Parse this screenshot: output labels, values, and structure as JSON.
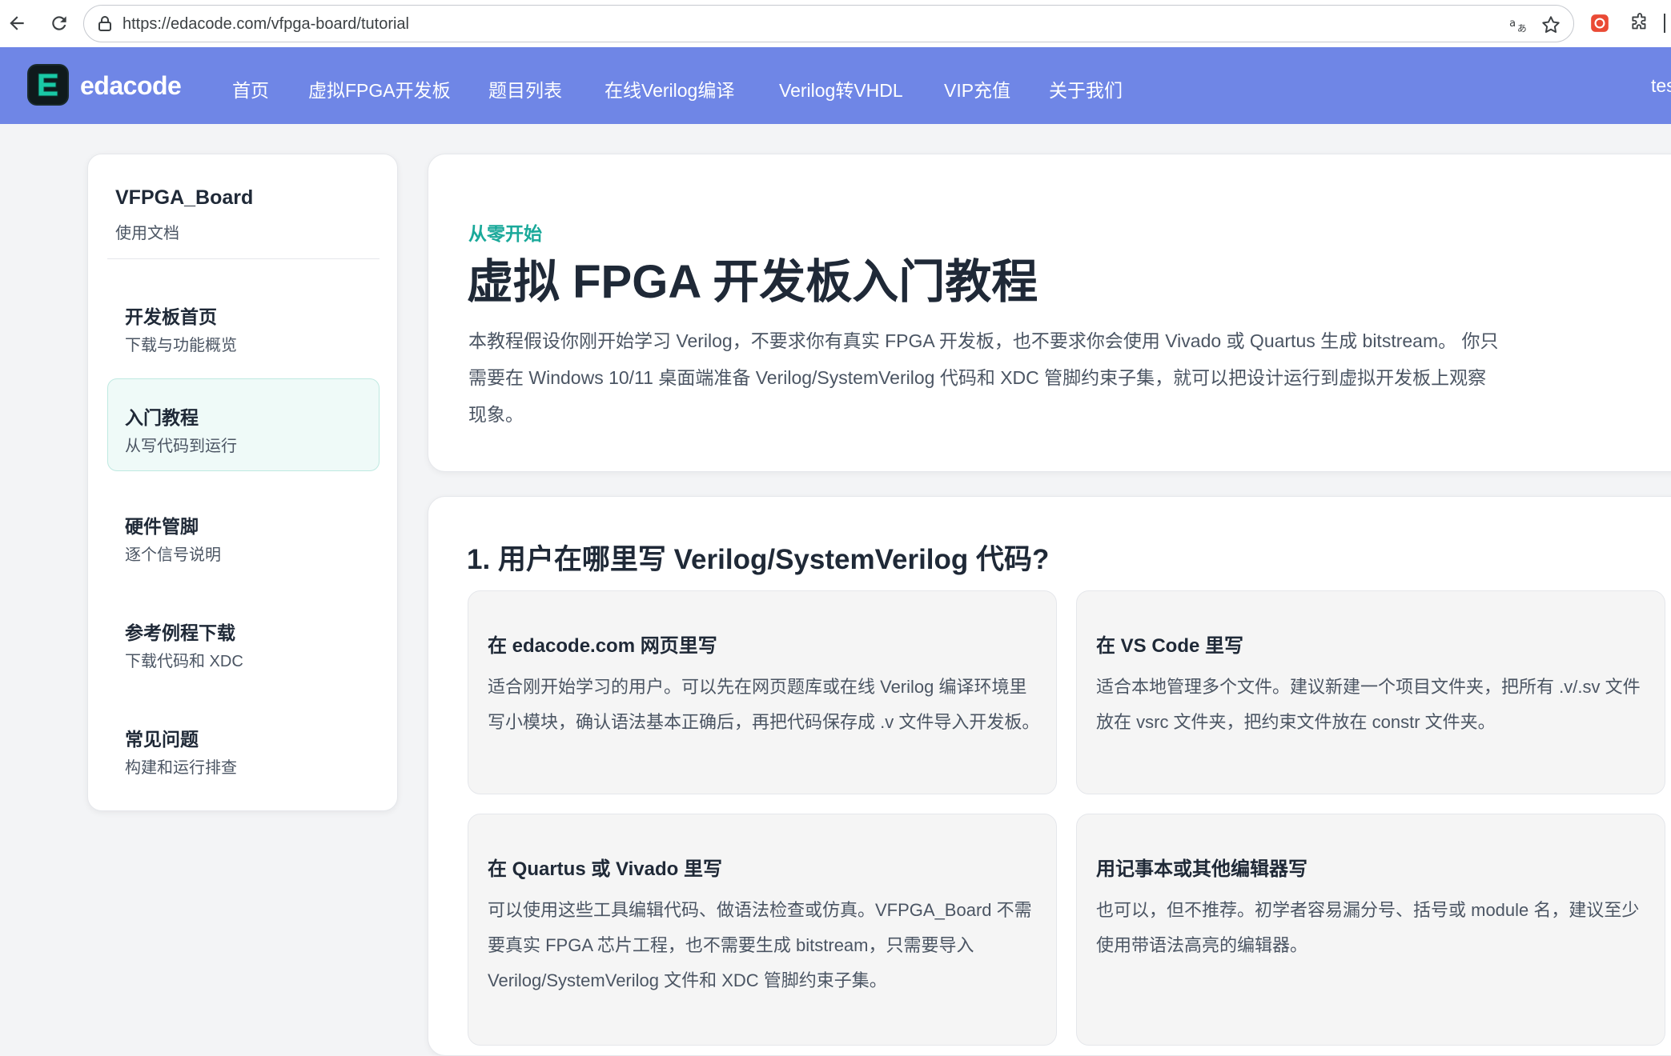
{
  "browser": {
    "url": "https://edacode.com/vfpga-board/tutorial"
  },
  "header": {
    "logo_text": "edacode",
    "nav": [
      {
        "label": "首页"
      },
      {
        "label": "虚拟FPGA开发板"
      },
      {
        "label": "题目列表"
      },
      {
        "label": "在线Verilog编译"
      },
      {
        "label": "Verilog转VHDL"
      },
      {
        "label": "VIP充值"
      },
      {
        "label": "关于我们"
      }
    ],
    "user_partial": "tes"
  },
  "sidebar": {
    "title": "VFPGA_Board",
    "subtitle": "使用文档",
    "items": [
      {
        "title": "开发板首页",
        "desc": "下载与功能概览"
      },
      {
        "title": "入门教程",
        "desc": "从写代码到运行"
      },
      {
        "title": "硬件管脚",
        "desc": "逐个信号说明"
      },
      {
        "title": "参考例程下载",
        "desc": "下载代码和 XDC"
      },
      {
        "title": "常见问题",
        "desc": "构建和运行排查"
      }
    ]
  },
  "hero": {
    "eyebrow": "从零开始",
    "title": "虚拟 FPGA 开发板入门教程",
    "desc": "本教程假设你刚开始学习 Verilog，不要求你有真实 FPGA 开发板，也不要求你会使用 Vivado 或 Quartus 生成 bitstream。 你只需要在 Windows 10/11 桌面端准备 Verilog/SystemVerilog 代码和 XDC 管脚约束子集，就可以把设计运行到虚拟开发板上观察现象。"
  },
  "section1": {
    "title": "1. 用户在哪里写 Verilog/SystemVerilog 代码?",
    "options": [
      {
        "title": "在 edacode.com 网页里写",
        "desc": "适合刚开始学习的用户。可以先在网页题库或在线 Verilog 编译环境里写小模块，确认语法基本正确后，再把代码保存成 .v 文件导入开发板。"
      },
      {
        "title": "在 VS Code 里写",
        "desc": "适合本地管理多个文件。建议新建一个项目文件夹，把所有 .v/.sv 文件放在 vsrc 文件夹，把约束文件放在 constr 文件夹。"
      },
      {
        "title": "在 Quartus 或 Vivado 里写",
        "desc": "可以使用这些工具编辑代码、做语法检查或仿真。VFPGA_Board 不需要真实 FPGA 芯片工程，也不需要生成 bitstream，只需要导入 Verilog/SystemVerilog 文件和 XDC 管脚约束子集。"
      },
      {
        "title": "用记事本或其他编辑器写",
        "desc": "也可以，但不推荐。初学者容易漏分号、括号或 module 名，建议至少使用带语法高亮的编辑器。"
      }
    ]
  },
  "colors": {
    "header_bg": "#6f86e6",
    "accent": "#1aa99a",
    "active_item_bg": "#effaf8"
  }
}
